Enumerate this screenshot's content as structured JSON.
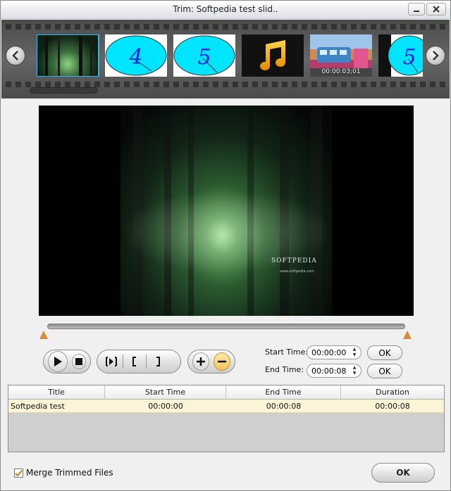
{
  "window": {
    "title": "Trim: Softpedia test slid.."
  },
  "filmstrip": {
    "thumbs": [
      {
        "kind": "forest",
        "time": ""
      },
      {
        "kind": "digit",
        "digit": "4"
      },
      {
        "kind": "digit",
        "digit": "5"
      },
      {
        "kind": "music"
      },
      {
        "kind": "bus",
        "time": "00:00:03;01"
      },
      {
        "kind": "digit",
        "digit": "5"
      }
    ]
  },
  "preview": {
    "watermark": "SOFTPEDIA",
    "watermark_sub": "www.softpedia.com"
  },
  "controls": {
    "start_time_label": "Start Time:",
    "start_time_value": "00:00:00",
    "end_time_label": "End Time:",
    "end_time_value": "00:00:08",
    "ok_label": "OK"
  },
  "table": {
    "headers": [
      "Title",
      "Start Time",
      "End Time",
      "Duration"
    ],
    "rows": [
      [
        "Softpedia test",
        "00:00:00",
        "00:00:08",
        "00:00:08"
      ]
    ]
  },
  "footer": {
    "merge_label": "Merge Trimmed Files",
    "merge_checked": true,
    "ok_label": "OK"
  },
  "colors": {
    "accent": "#29b6f6",
    "marker": "#d88c3a",
    "row_highlight": "#fbf4d6"
  }
}
